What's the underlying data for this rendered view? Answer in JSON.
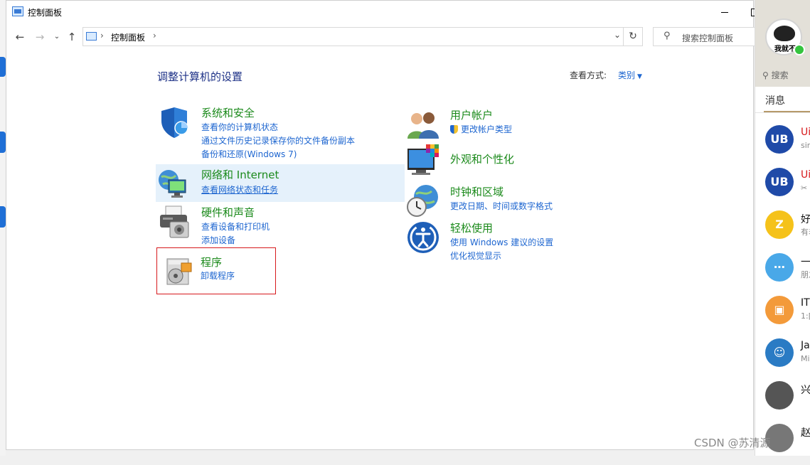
{
  "window": {
    "title": "控制面板",
    "minimize_icon": "minimize-icon",
    "maximize_icon": "maximize-icon"
  },
  "navigation": {
    "back_icon": "back-arrow-icon",
    "forward_icon": "forward-arrow-icon",
    "recent_icon": "chevron-down-icon",
    "up_icon": "up-arrow-icon",
    "breadcrumb": "控制面板",
    "refresh_icon": "refresh-icon",
    "search_placeholder": "搜索控制面板"
  },
  "main": {
    "page_title": "调整计算机的设置",
    "view_by_label": "查看方式:",
    "view_by_value": "类别",
    "categories_left": [
      {
        "title": "系统和安全",
        "icon": "shield-icon",
        "links": [
          "查看你的计算机状态",
          "通过文件历史记录保存你的文件备份副本",
          "备份和还原(Windows 7)"
        ]
      },
      {
        "title": "网络和 Internet",
        "icon": "network-globe-icon",
        "links": [
          "查看网络状态和任务"
        ],
        "state": "hover"
      },
      {
        "title": "硬件和声音",
        "icon": "printer-icon",
        "links": [
          "查看设备和打印机",
          "添加设备"
        ]
      },
      {
        "title": "程序",
        "icon": "programs-disc-icon",
        "links": [
          "卸载程序"
        ],
        "state": "highlighted"
      }
    ],
    "categories_right": [
      {
        "title": "用户帐户",
        "icon": "users-icon",
        "links": [
          "更改帐户类型"
        ]
      },
      {
        "title": "外观和个性化",
        "icon": "monitor-palette-icon",
        "links": []
      },
      {
        "title": "时钟和区域",
        "icon": "clock-globe-icon",
        "links": [
          "更改日期、时间或数字格式"
        ]
      },
      {
        "title": "轻松使用",
        "icon": "accessibility-icon",
        "links": [
          "使用 Windows 建议的设置",
          "优化视觉显示"
        ]
      }
    ]
  },
  "qq_sidebar": {
    "avatar_caption": "我就不",
    "search_label": "搜索",
    "tab": "消息",
    "items": [
      {
        "name": "Ui",
        "sub": "sir",
        "avatar": "UB",
        "color": "#1f4aa8",
        "name_red": true
      },
      {
        "name": "Ui",
        "sub": "✂",
        "avatar": "UB",
        "color": "#1f4aa8",
        "name_red": true
      },
      {
        "name": "好",
        "sub": "有着",
        "avatar": "Z",
        "color": "#f5c21a",
        "name_red": false
      },
      {
        "name": "一",
        "sub": "朋友",
        "avatar": "⋯",
        "color": "#49a8e8",
        "name_red": false
      },
      {
        "name": "IT",
        "sub": "1:[",
        "avatar": "▣",
        "color": "#f39a3a",
        "name_red": false
      },
      {
        "name": "Ja",
        "sub": "Mi",
        "avatar": "☺",
        "color": "#2a7bc4",
        "name_red": false
      },
      {
        "name": "兴",
        "sub": "",
        "avatar": "",
        "color": "#555555",
        "name_red": false
      },
      {
        "name": "赵",
        "sub": "",
        "avatar": "",
        "color": "#777777",
        "name_red": false
      }
    ]
  },
  "watermark": "CSDN @苏清源"
}
